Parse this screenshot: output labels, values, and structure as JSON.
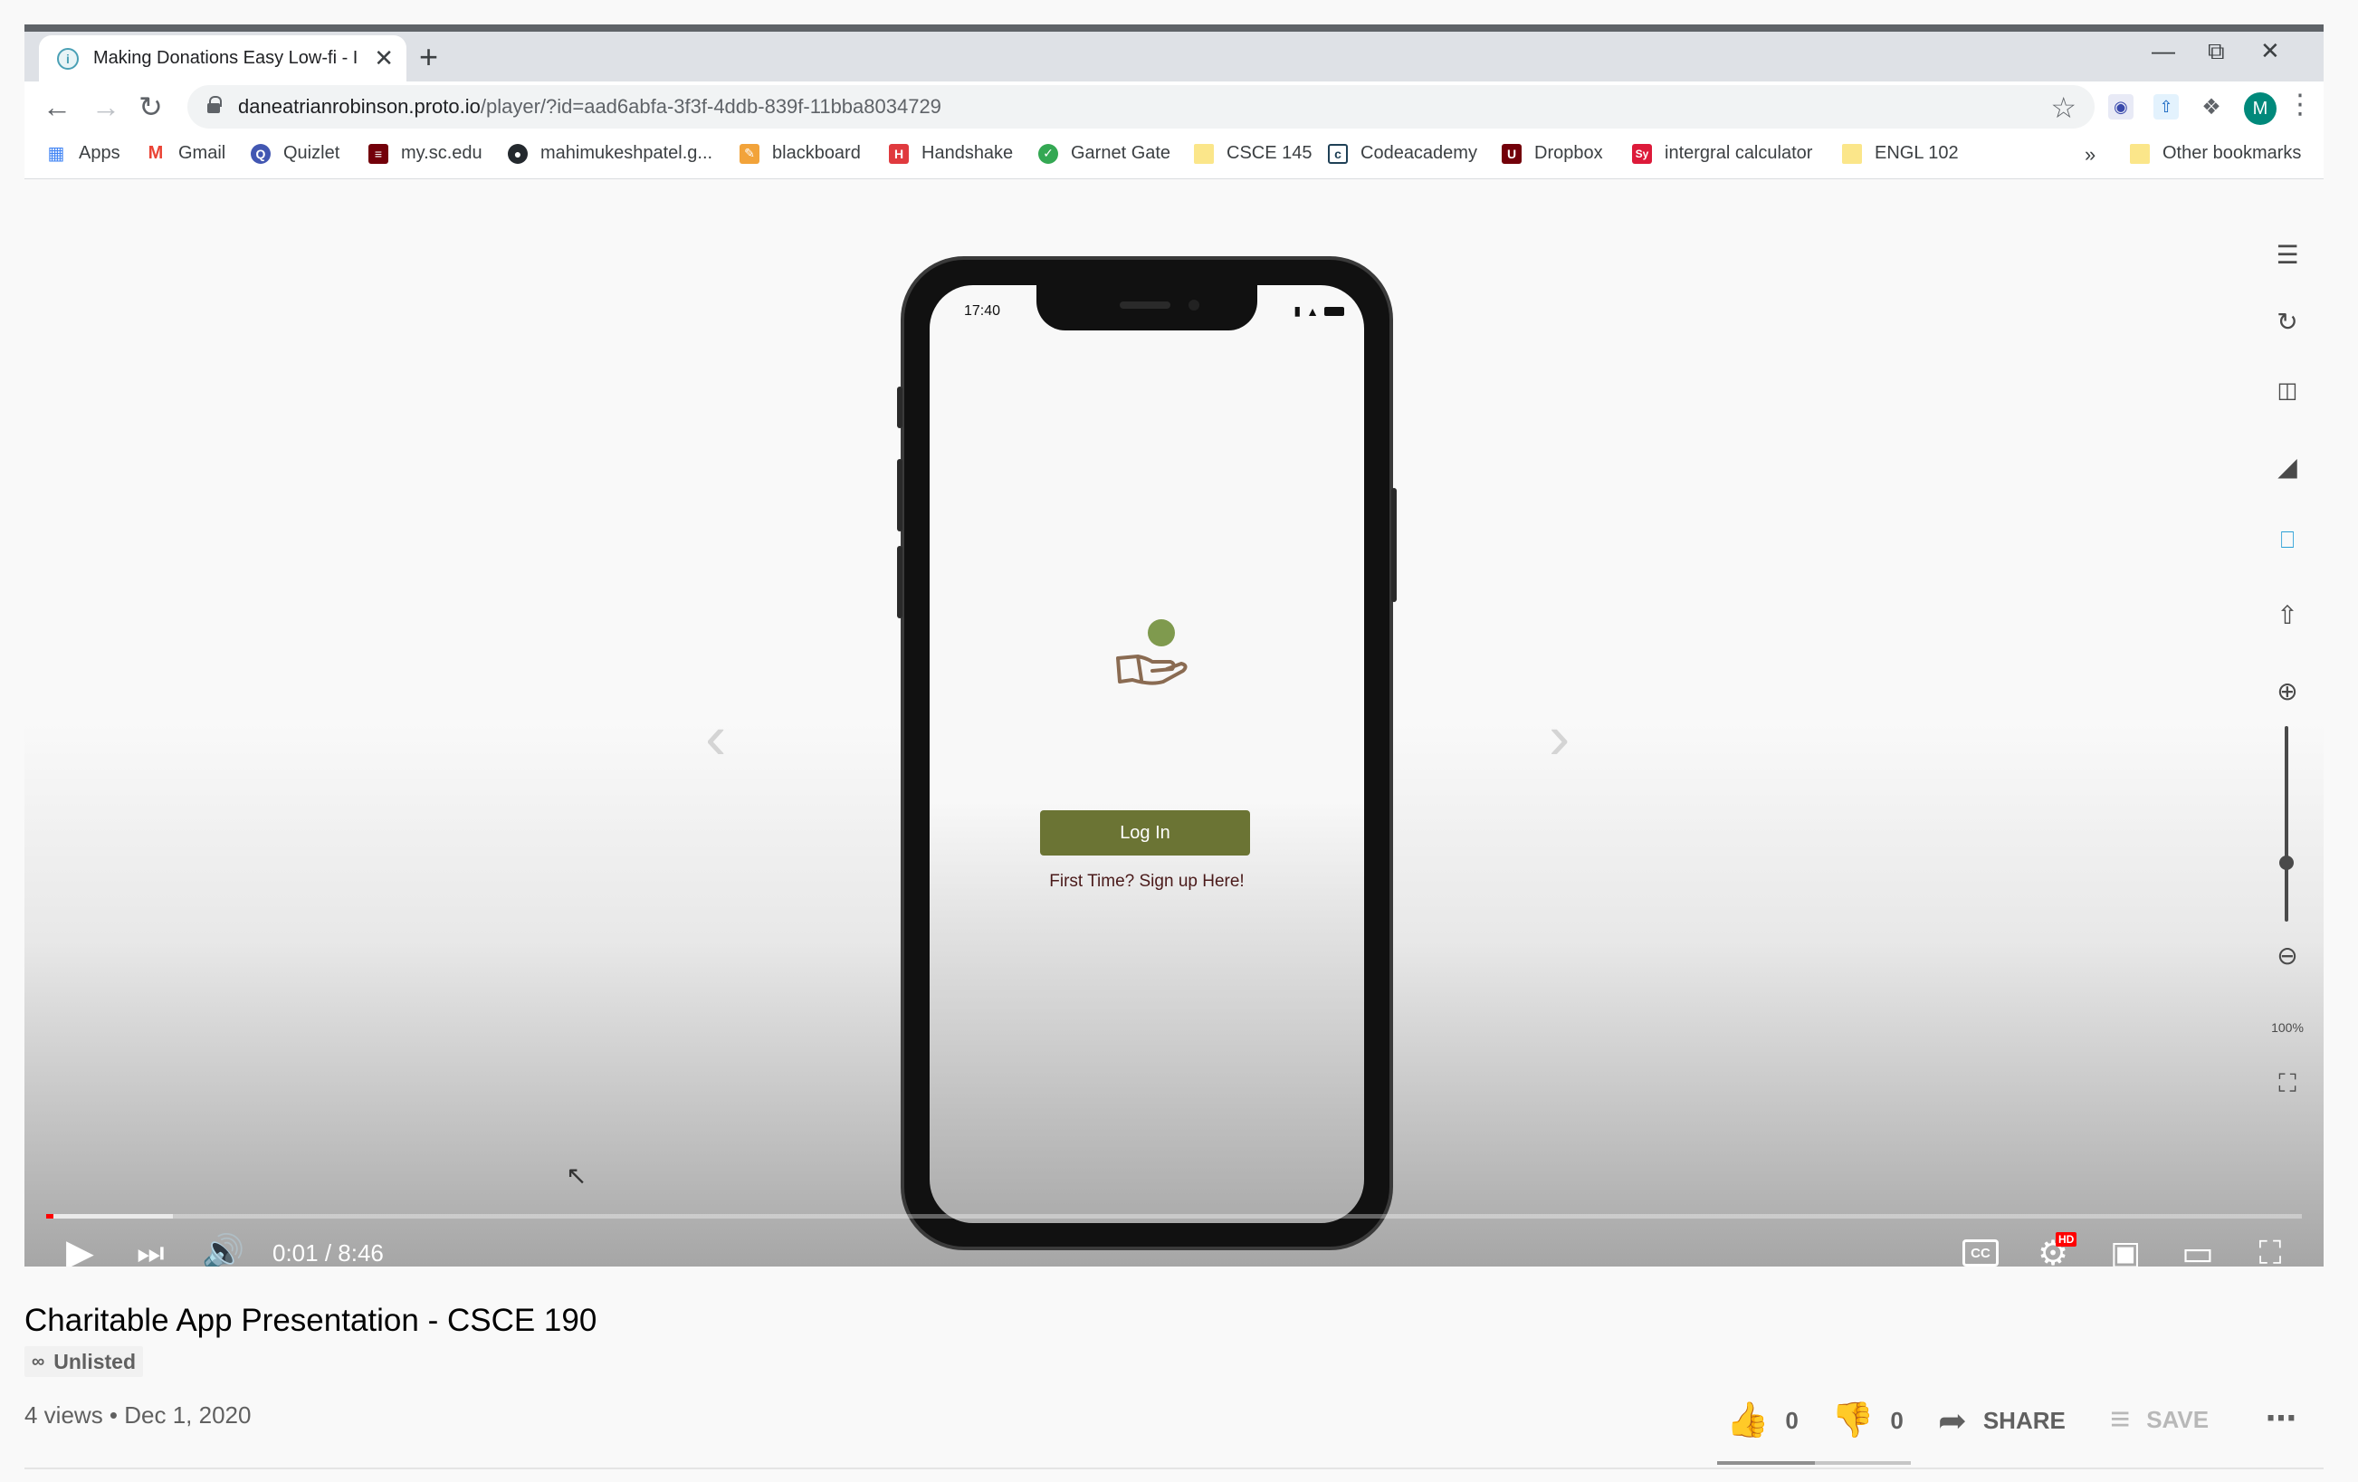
{
  "browser": {
    "tab_title": "Making Donations Easy Low-fi - I",
    "tab_close": "✕",
    "new_tab": "+",
    "url_host": "daneatrianrobinson.proto.io",
    "url_path": "/player/?id=aad6abfa-3f3f-4ddb-839f-11bba8034729",
    "profile_initial": "M"
  },
  "bookmarks": [
    {
      "label": "Apps",
      "color": "#4285f4"
    },
    {
      "label": "Gmail",
      "color": "#ea4335"
    },
    {
      "label": "Quizlet",
      "color": "#4257b2"
    },
    {
      "label": "my.sc.edu",
      "color": "#73000a"
    },
    {
      "label": "mahimukeshpatel.g...",
      "color": "#24292e"
    },
    {
      "label": "blackboard",
      "color": "#f2a33a"
    },
    {
      "label": "Handshake",
      "color": "#e03a3e"
    },
    {
      "label": "Garnet Gate",
      "color": "#34a853"
    },
    {
      "label": "CSCE 145",
      "color": "#fbe68a"
    },
    {
      "label": "Codeacademy",
      "color": "#1f4056"
    },
    {
      "label": "Dropbox",
      "color": "#73000a"
    },
    {
      "label": "intergral calculator",
      "color": "#dd1a3a"
    },
    {
      "label": "ENGL 102",
      "color": "#fbe68a"
    }
  ],
  "bookmarks_more": "»",
  "other_bookmarks": "Other bookmarks",
  "prototype": {
    "time": "17:40",
    "login_label": "Log In",
    "signup_label": "First Time? Sign up Here!",
    "accent": "#6b7434",
    "logo_dot": "#7f9a4e",
    "logo_hand": "#8a6b52"
  },
  "tools": {
    "zoom_label": "100%",
    "zoom_level": 0.3
  },
  "player": {
    "current_time": "0:01",
    "duration": "8:46",
    "timecode": "0:01 / 8:46",
    "cc": "CC",
    "hd": "HD",
    "progress_fraction": 0.002
  },
  "video": {
    "title": "Charitable App Presentation - CSCE 190",
    "visibility": "Unlisted",
    "meta": "4 views • Dec 1, 2020",
    "likes": "0",
    "dislikes": "0",
    "share": "SHARE",
    "save": "SAVE"
  }
}
